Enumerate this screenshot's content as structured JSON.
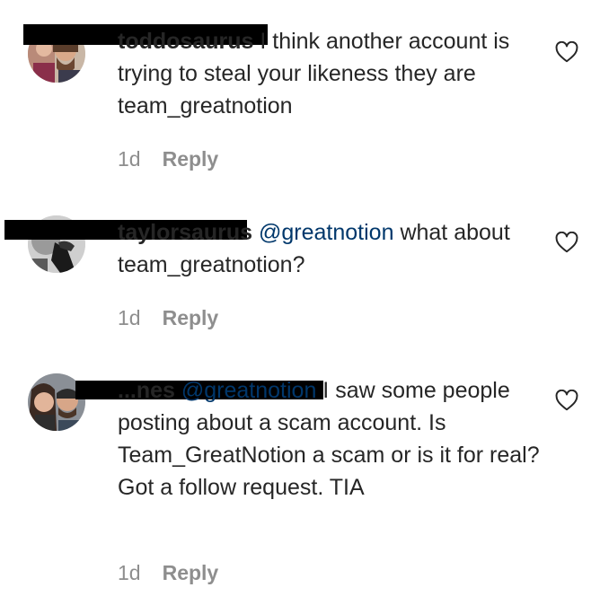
{
  "comments": [
    {
      "username": "toddosaurus",
      "mention": "",
      "text": " I think another account is trying to steal your likeness they are team_greatnotion",
      "time": "1d",
      "reply_label": "Reply",
      "like_icon": "heart-outline-icon"
    },
    {
      "username": "taylorsaurus",
      "mention": "@greatnotion",
      "text": " what about team_greatnotion?",
      "time": "1d",
      "reply_label": "Reply",
      "like_icon": "heart-outline-icon"
    },
    {
      "username": "...nes",
      "mention": "@greatnotion",
      "text": " I saw some people posting about a scam account. Is Team_GreatNotion a scam or is it for real? Got a follow request. TIA",
      "time": "1d",
      "reply_label": "Reply",
      "like_icon": "heart-outline-icon"
    }
  ],
  "colors": {
    "text": "#262626",
    "mention": "#00376b",
    "meta": "#8e8e8e",
    "redaction": "#000000"
  }
}
